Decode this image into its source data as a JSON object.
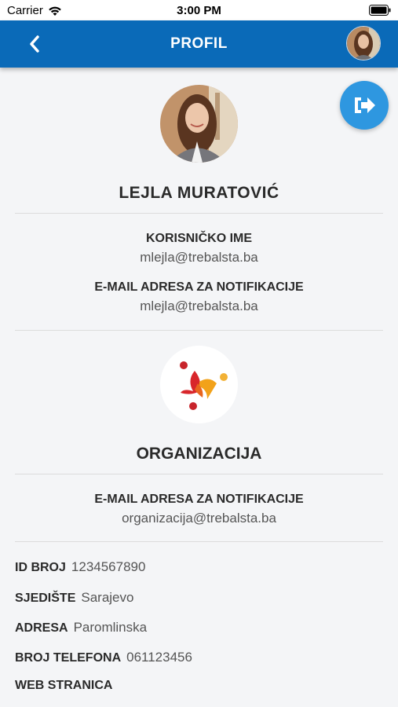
{
  "status_bar": {
    "carrier": "Carrier",
    "time": "3:00 PM"
  },
  "nav": {
    "title": "PROFIL"
  },
  "user": {
    "name": "LEJLA MURATOVIĆ",
    "username_label": "KORISNIČKO IME",
    "username_value": "mlejla@trebalsta.ba",
    "email_label": "E-MAIL ADRESA ZA NOTIFIKACIJE",
    "email_value": "mlejla@trebalsta.ba"
  },
  "organization": {
    "title": "ORGANIZACIJA",
    "email_label": "E-MAIL ADRESA ZA NOTIFIKACIJE",
    "email_value": "organizacija@trebalsta.ba",
    "details": [
      {
        "label": "ID BROJ",
        "value": "1234567890"
      },
      {
        "label": "SJEDIŠTE",
        "value": "Sarajevo"
      },
      {
        "label": "ADRESA",
        "value": "Paromlinska"
      },
      {
        "label": "BROJ TELEFONA",
        "value": "061123456"
      },
      {
        "label": "WEB STRANICA",
        "value": ""
      }
    ]
  },
  "colors": {
    "nav": "#0a6ab8",
    "logout_button": "#2e97e0",
    "background": "#f4f5f7"
  },
  "icons": [
    "wifi-icon",
    "battery-icon",
    "back-chevron-icon",
    "logout-icon"
  ]
}
